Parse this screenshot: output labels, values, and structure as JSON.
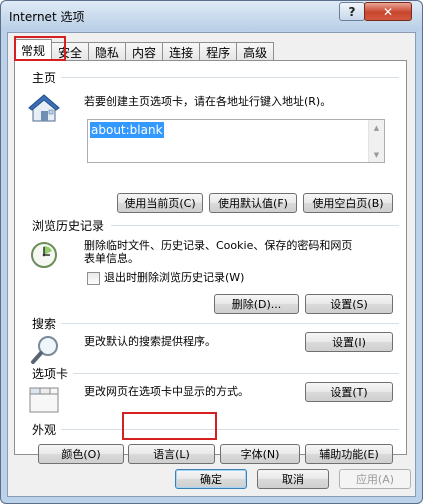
{
  "window": {
    "title": "Internet 选项",
    "help": "?",
    "close": "✕"
  },
  "tabs": [
    {
      "label": "常规",
      "active": true
    },
    {
      "label": "安全",
      "active": false
    },
    {
      "label": "隐私",
      "active": false
    },
    {
      "label": "内容",
      "active": false
    },
    {
      "label": "连接",
      "active": false
    },
    {
      "label": "程序",
      "active": false
    },
    {
      "label": "高级",
      "active": false
    }
  ],
  "home": {
    "title": "主页",
    "desc": "若要创建主页选项卡，请在各地址行键入地址(R)。",
    "value": "about:blank",
    "btn_current": "使用当前页(C)",
    "btn_default": "使用默认值(F)",
    "btn_blank": "使用空白页(B)"
  },
  "history": {
    "title": "浏览历史记录",
    "desc_line1": "删除临时文件、历史记录、Cookie、保存的密码和网页",
    "desc_line2": "表单信息。",
    "checkbox_label": "退出时删除浏览历史记录(W)",
    "btn_delete": "删除(D)...",
    "btn_settings": "设置(S)"
  },
  "search": {
    "title": "搜索",
    "desc": "更改默认的搜索提供程序。",
    "btn_settings": "设置(I)"
  },
  "tabs_group": {
    "title": "选项卡",
    "desc": "更改网页在选项卡中显示的方式。",
    "btn_settings": "设置(T)"
  },
  "appearance": {
    "title": "外观",
    "btn_colors": "颜色(O)",
    "btn_languages": "语言(L)",
    "btn_fonts": "字体(N)",
    "btn_accessibility": "辅助功能(E)"
  },
  "footer": {
    "ok": "确定",
    "cancel": "取消",
    "apply": "应用(A)"
  },
  "colors": {
    "highlight": "#d42020",
    "selection": "#3399ff"
  }
}
